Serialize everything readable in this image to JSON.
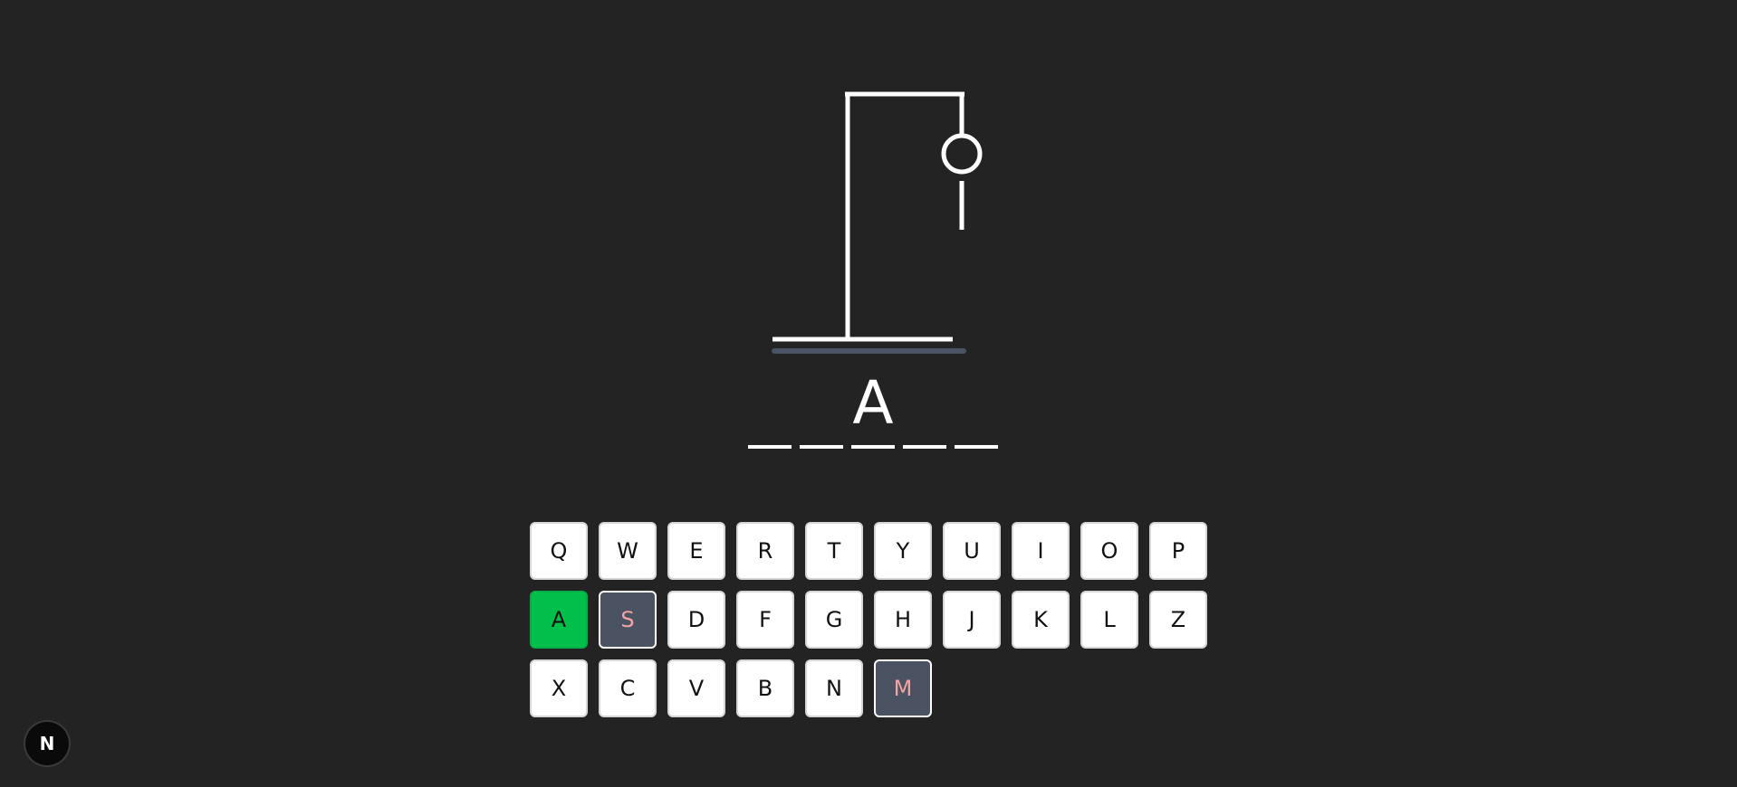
{
  "game": {
    "word_slots": [
      "",
      "",
      "A",
      "",
      ""
    ],
    "keyboard_rows": [
      [
        {
          "letter": "Q",
          "state": "unused"
        },
        {
          "letter": "W",
          "state": "unused"
        },
        {
          "letter": "E",
          "state": "unused"
        },
        {
          "letter": "R",
          "state": "unused"
        },
        {
          "letter": "T",
          "state": "unused"
        },
        {
          "letter": "Y",
          "state": "unused"
        },
        {
          "letter": "U",
          "state": "unused"
        },
        {
          "letter": "I",
          "state": "unused"
        },
        {
          "letter": "O",
          "state": "unused"
        },
        {
          "letter": "P",
          "state": "unused"
        }
      ],
      [
        {
          "letter": "A",
          "state": "correct"
        },
        {
          "letter": "S",
          "state": "wrong"
        },
        {
          "letter": "D",
          "state": "unused"
        },
        {
          "letter": "F",
          "state": "unused"
        },
        {
          "letter": "G",
          "state": "unused"
        },
        {
          "letter": "H",
          "state": "unused"
        },
        {
          "letter": "J",
          "state": "unused"
        },
        {
          "letter": "K",
          "state": "unused"
        },
        {
          "letter": "L",
          "state": "unused"
        },
        {
          "letter": "Z",
          "state": "unused"
        }
      ],
      [
        {
          "letter": "X",
          "state": "unused"
        },
        {
          "letter": "C",
          "state": "unused"
        },
        {
          "letter": "V",
          "state": "unused"
        },
        {
          "letter": "B",
          "state": "unused"
        },
        {
          "letter": "N",
          "state": "unused"
        },
        {
          "letter": "M",
          "state": "wrong"
        }
      ]
    ],
    "hangman_parts_shown": [
      "head",
      "body"
    ]
  },
  "badge": {
    "label": "N",
    "icon": "nextjs-logo-icon"
  },
  "colors": {
    "background": "#232323",
    "correct": "#00c04b",
    "wrong_bg": "#4b5261",
    "wrong_text": "#f4a3a3",
    "ground": "#4a5363"
  }
}
